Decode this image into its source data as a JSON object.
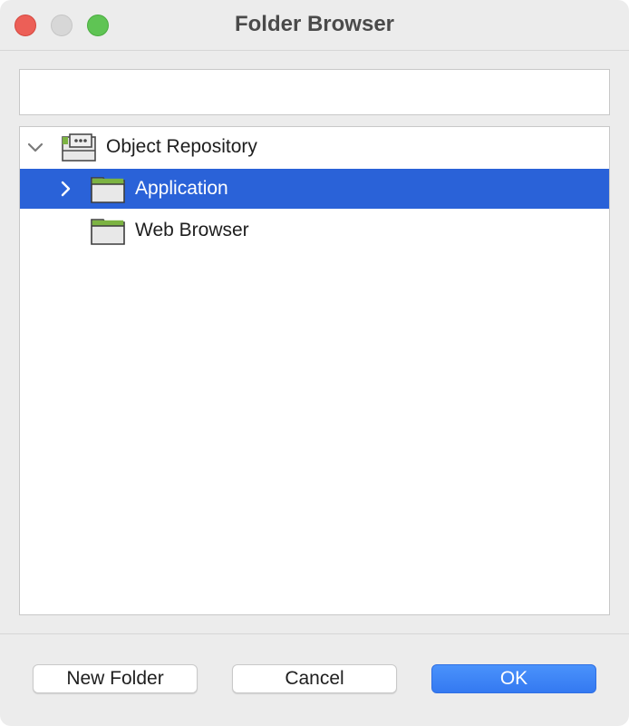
{
  "window": {
    "title": "Folder Browser"
  },
  "path_field": {
    "value": ""
  },
  "tree": {
    "root": {
      "label": "Object Repository",
      "expanded": true,
      "icon": "repository-icon"
    },
    "children": [
      {
        "label": "Application",
        "selected": true,
        "expandable": true,
        "icon": "folder-icon"
      },
      {
        "label": "Web Browser",
        "selected": false,
        "expandable": false,
        "icon": "folder-icon"
      }
    ]
  },
  "buttons": {
    "new_folder": "New Folder",
    "cancel": "Cancel",
    "ok": "OK"
  },
  "colors": {
    "selection": "#2a62d8",
    "folder_tab": "#7cb342",
    "primary_button": "#3d84f7"
  }
}
